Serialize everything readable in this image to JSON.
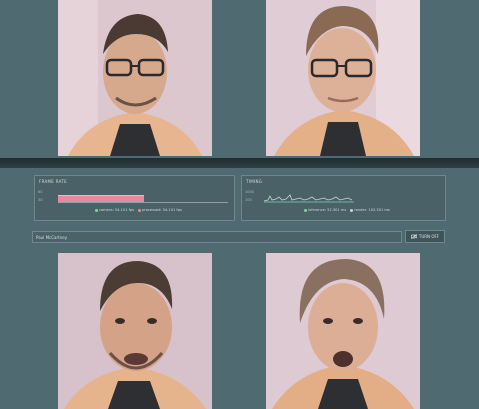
{
  "frame_rate_panel": {
    "title": "FRAME RATE",
    "y_top": "60",
    "y_bottom": "30",
    "legend": [
      {
        "label": "camera: 54.101 fps",
        "color": "#7fd3a8"
      },
      {
        "label": "processed: 54.101 fps",
        "color": "#e38aa1"
      }
    ]
  },
  "timing_panel": {
    "title": "TIMING",
    "y_top": "1000",
    "y_bottom": "100",
    "legend": [
      {
        "label": "inference: 52.301 ms",
        "color": "#7fd3a8"
      },
      {
        "label": "render: 102.301 ms",
        "color": "#c9d5d8"
      }
    ]
  },
  "name_input": {
    "value": "Paul McCartney"
  },
  "turn_off_button": {
    "label": "TURN OFF",
    "icon": "camera-off-icon"
  },
  "colors": {
    "background": "#4f6a70",
    "accent_pink": "#e38aa1",
    "accent_green": "#7fd3a8"
  }
}
